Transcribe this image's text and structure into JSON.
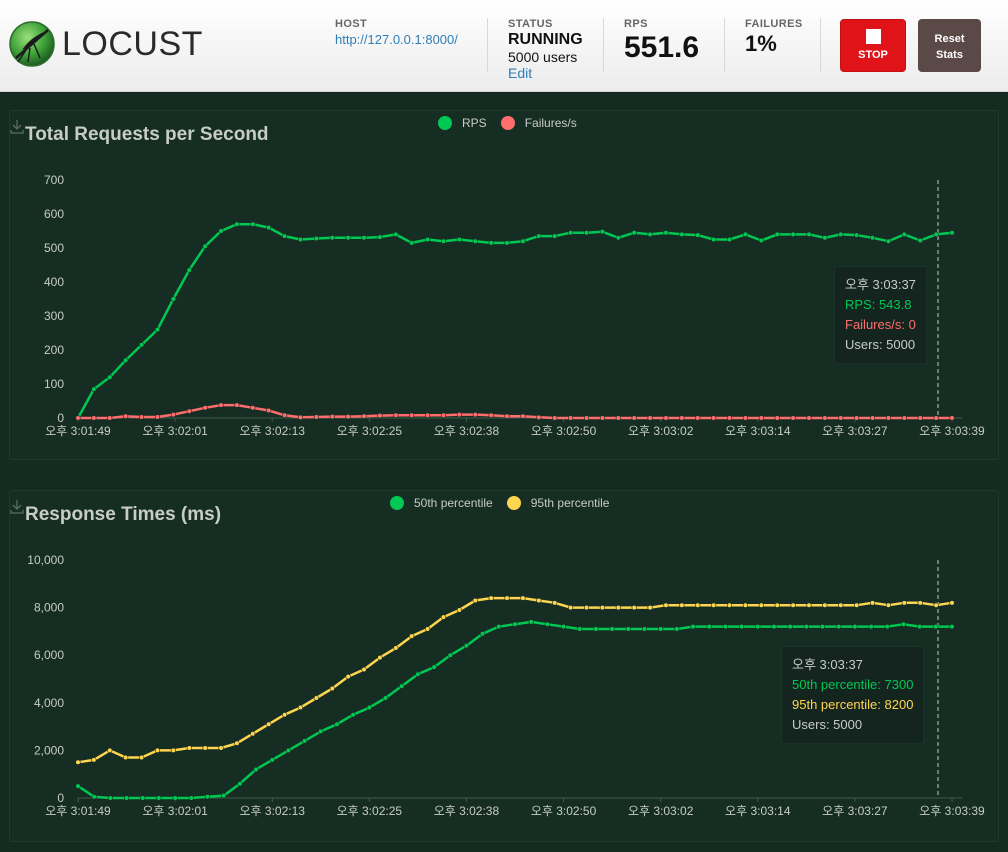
{
  "app": {
    "name": "LOCUST"
  },
  "header": {
    "host_label": "HOST",
    "host_value": "http://127.0.0.1:8000/",
    "status_label": "STATUS",
    "status_value": "RUNNING",
    "users_value": "5000 users",
    "edit_label": "Edit",
    "rps_label": "RPS",
    "rps_value": "551.6",
    "failures_label": "FAILURES",
    "failures_value": "1%",
    "stop_label": "STOP",
    "reset_label_line1": "Reset",
    "reset_label_line2": "Stats"
  },
  "colors": {
    "rps": "#00c853",
    "failures": "#ff6d6d",
    "p50": "#00c853",
    "p95": "#ffd54f",
    "stop": "#e01319",
    "reset": "#5a4946"
  },
  "chart_data": [
    {
      "type": "line",
      "title": "Total Requests per Second",
      "x_ticks": [
        "오후 3:01:49",
        "오후 3:02:01",
        "오후 3:02:13",
        "오후 3:02:25",
        "오후 3:02:38",
        "오후 3:02:50",
        "오후 3:03:02",
        "오후 3:03:14",
        "오후 3:03:27",
        "오후 3:03:39"
      ],
      "y_ticks": [
        "700",
        "600",
        "500",
        "400",
        "300",
        "200",
        "100",
        "0"
      ],
      "ylim": [
        0,
        700
      ],
      "series": [
        {
          "name": "RPS",
          "values": [
            0,
            85,
            120,
            170,
            215,
            260,
            350,
            435,
            505,
            550,
            570,
            570,
            560,
            535,
            525,
            528,
            530,
            530,
            530,
            532,
            540,
            515,
            525,
            520,
            525,
            520,
            515,
            515,
            520,
            535,
            535,
            545,
            545,
            548,
            530,
            545,
            540,
            545,
            540,
            538,
            525,
            525,
            540,
            522,
            540,
            540,
            540,
            530,
            540,
            538,
            530,
            520,
            540,
            522,
            540,
            545
          ]
        },
        {
          "name": "Failures/s",
          "values": [
            0,
            0,
            0,
            5,
            3,
            3,
            10,
            20,
            30,
            38,
            38,
            30,
            22,
            8,
            2,
            3,
            4,
            4,
            5,
            7,
            8,
            8,
            8,
            8,
            10,
            10,
            8,
            5,
            5,
            2,
            0,
            0,
            0,
            0,
            0,
            0,
            0,
            0,
            0,
            0,
            0,
            0,
            0,
            0,
            0,
            0,
            0,
            0,
            0,
            0,
            0,
            0,
            0,
            0,
            0,
            0
          ]
        }
      ],
      "tooltip": {
        "time": "오후 3:03:37",
        "rps_line": "RPS: 543.8",
        "fail_line": "Failures/s: 0",
        "users_line": "Users: 5000"
      },
      "legend_items": [
        "RPS",
        "Failures/s"
      ]
    },
    {
      "type": "line",
      "title": "Response Times (ms)",
      "x_ticks": [
        "오후 3:01:49",
        "오후 3:02:01",
        "오후 3:02:13",
        "오후 3:02:25",
        "오후 3:02:38",
        "오후 3:02:50",
        "오후 3:03:02",
        "오후 3:03:14",
        "오후 3:03:27",
        "오후 3:03:39"
      ],
      "y_ticks": [
        "10,000",
        "8,000",
        "6,000",
        "4,000",
        "2,000",
        "0"
      ],
      "ylim": [
        0,
        10000
      ],
      "series": [
        {
          "name": "50th percentile",
          "values": [
            500,
            50,
            0,
            0,
            0,
            0,
            0,
            0,
            50,
            100,
            600,
            1200,
            1600,
            2000,
            2400,
            2800,
            3100,
            3500,
            3800,
            4200,
            4700,
            5200,
            5500,
            6000,
            6400,
            6900,
            7200,
            7300,
            7400,
            7300,
            7200,
            7100,
            7100,
            7100,
            7100,
            7100,
            7100,
            7100,
            7200,
            7200,
            7200,
            7200,
            7200,
            7200,
            7200,
            7200,
            7200,
            7200,
            7200,
            7200,
            7200,
            7300,
            7200,
            7200,
            7200
          ]
        },
        {
          "name": "95th percentile",
          "values": [
            1500,
            1600,
            2000,
            1700,
            1700,
            2000,
            2000,
            2100,
            2100,
            2100,
            2300,
            2700,
            3100,
            3500,
            3800,
            4200,
            4600,
            5100,
            5400,
            5900,
            6300,
            6800,
            7100,
            7600,
            7900,
            8300,
            8400,
            8400,
            8400,
            8300,
            8200,
            8000,
            8000,
            8000,
            8000,
            8000,
            8000,
            8100,
            8100,
            8100,
            8100,
            8100,
            8100,
            8100,
            8100,
            8100,
            8100,
            8100,
            8100,
            8100,
            8200,
            8100,
            8200,
            8200,
            8100,
            8200
          ]
        }
      ],
      "tooltip": {
        "time": "오후 3:03:37",
        "p50_line": "50th percentile: 7300",
        "p95_line": "95th percentile: 8200",
        "users_line": "Users: 5000"
      },
      "legend_items": [
        "50th percentile",
        "95th percentile"
      ]
    }
  ]
}
